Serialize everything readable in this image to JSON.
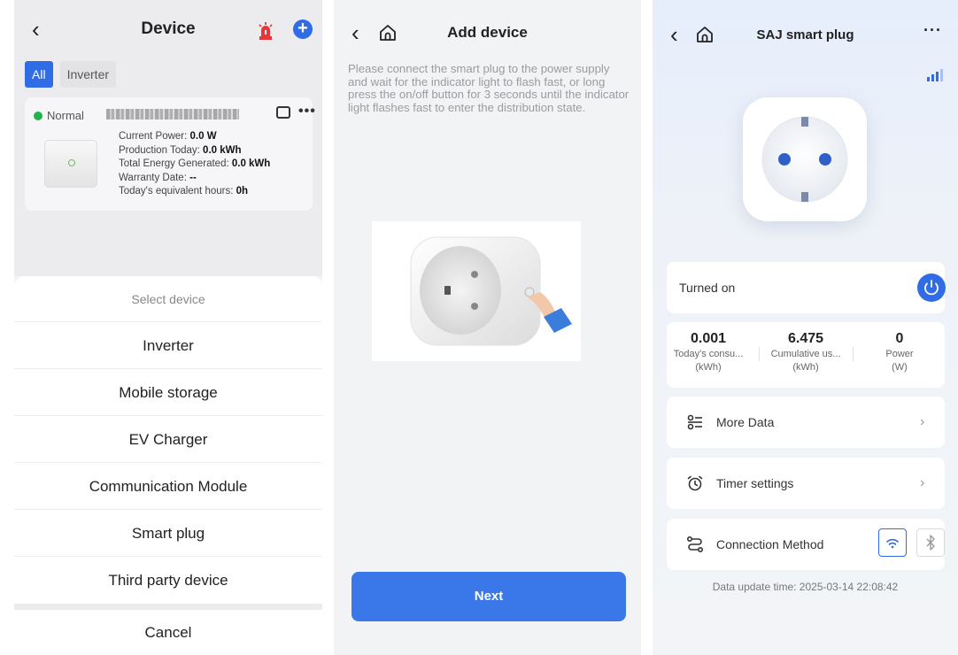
{
  "screen1": {
    "header": {
      "title": "Device"
    },
    "tabs": [
      "All",
      "Inverter"
    ],
    "device_card": {
      "status": "Normal",
      "lines": [
        {
          "label": "Current Power: ",
          "value": "0.0 W"
        },
        {
          "label": "Production Today: ",
          "value": "0.0 kWh"
        },
        {
          "label": "Total Energy Generated: ",
          "value": "0.0 kWh"
        },
        {
          "label": "Warranty Date: ",
          "value": "--"
        },
        {
          "label": "Today's equivalent hours: ",
          "value": "0h"
        }
      ]
    },
    "sheet": {
      "title": "Select device",
      "items": [
        "Inverter",
        "Mobile storage",
        "EV Charger",
        "Communication Module",
        "Smart plug",
        "Third party device"
      ],
      "cancel": "Cancel"
    }
  },
  "screen2": {
    "header": {
      "title": "Add device"
    },
    "instruction": "Please connect the smart plug to the power supply and wait for the indicator light to flash fast, or long press the on/off button for 3 seconds until the indicator light flashes fast to enter the distribution state.",
    "next_label": "Next"
  },
  "screen3": {
    "header": {
      "title": "SAJ smart plug",
      "more": "···"
    },
    "state_label": "Turned on",
    "stats": [
      {
        "value": "0.001",
        "label": "Today's consu...",
        "unit": "(kWh)"
      },
      {
        "value": "6.475",
        "label": "Cumulative us...",
        "unit": "(kWh)"
      },
      {
        "value": "0",
        "label": "Power",
        "unit": "(W)"
      }
    ],
    "rows": {
      "more_data": "More Data",
      "timer": "Timer settings",
      "connection": "Connection Method"
    },
    "update_time": "Data update time: 2025-03-14 22:08:42"
  },
  "colors": {
    "accent": "#2f6ce5",
    "status_green": "#22b14c",
    "alarm_red": "#e8353a"
  }
}
